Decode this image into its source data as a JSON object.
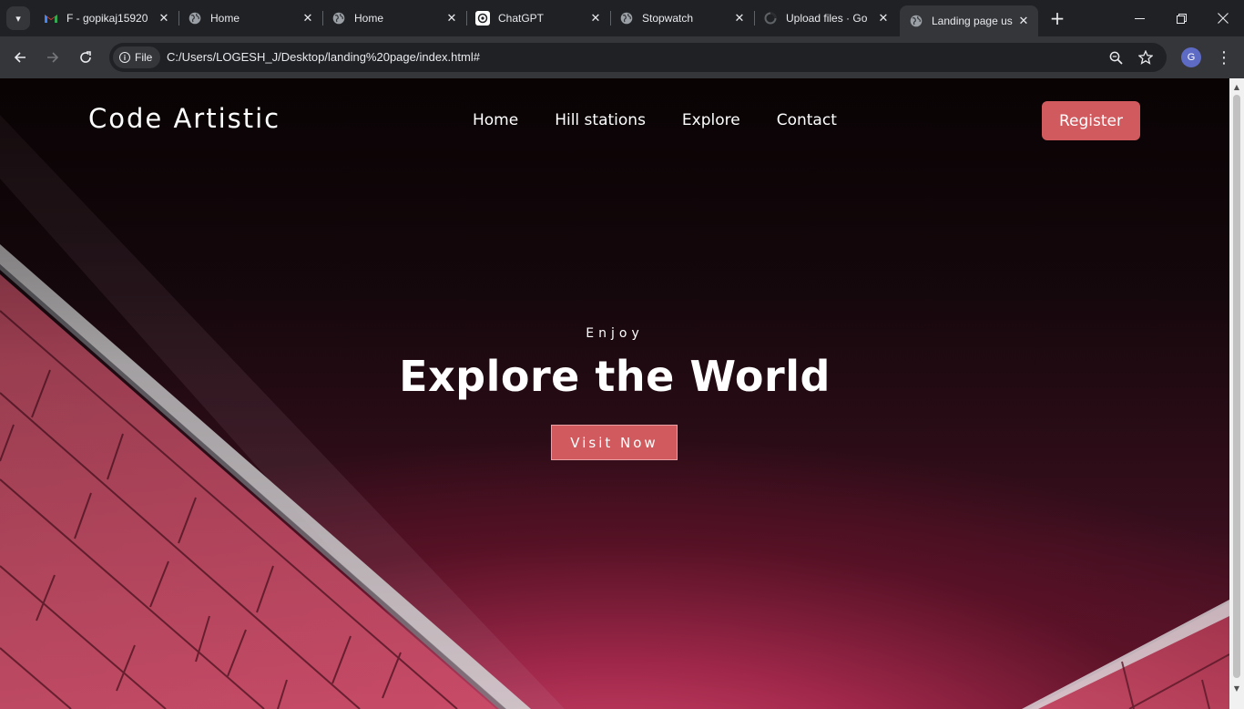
{
  "browser": {
    "tabs": [
      {
        "title": "F - gopikaj15920",
        "icon": "gmail-icon"
      },
      {
        "title": "Home",
        "icon": "globe-icon"
      },
      {
        "title": "Home",
        "icon": "globe-icon"
      },
      {
        "title": "ChatGPT",
        "icon": "chatgpt-icon"
      },
      {
        "title": "Stopwatch",
        "icon": "globe-icon"
      },
      {
        "title": "Upload files · Go",
        "icon": "loading-icon"
      },
      {
        "title": "Landing page us",
        "icon": "globe-icon",
        "active": true
      }
    ],
    "chip_label": "File",
    "url": "C:/Users/LOGESH_J/Desktop/landing%20page/index.html#",
    "profile_initial": "G"
  },
  "site": {
    "brand": "Code Artistic",
    "nav": [
      "Home",
      "Hill stations",
      "Explore",
      "Contact"
    ],
    "register_label": "Register",
    "hero": {
      "kicker": "Enjoy",
      "headline": "Explore the World",
      "cta": "Visit Now"
    }
  },
  "colors": {
    "accent": "#d15a5e",
    "hero_dark": "#140609",
    "hero_glow": "#d1476c"
  }
}
